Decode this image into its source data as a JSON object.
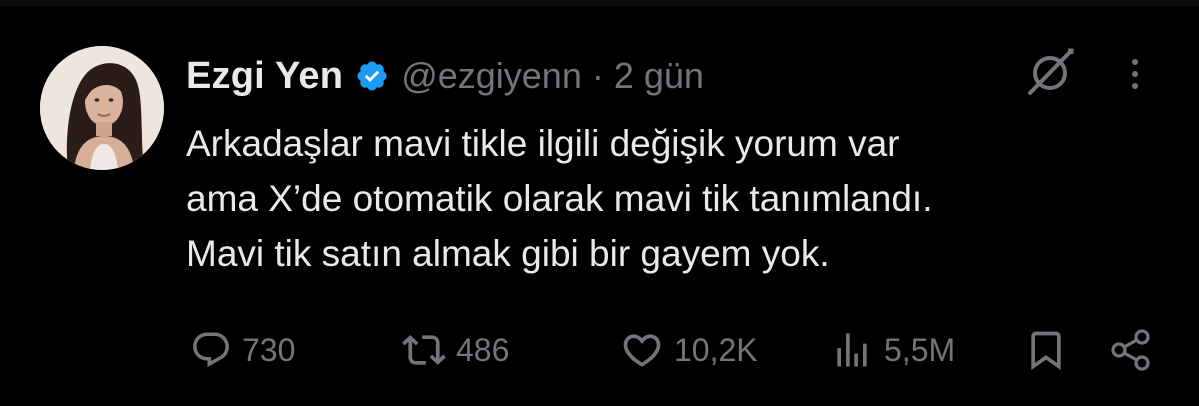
{
  "user": {
    "name": "Ezgi Yen",
    "handle": "@ezgiyenn",
    "separator": "·",
    "time": "2 gün",
    "verified_color": "#1d9bf0"
  },
  "tweet": {
    "lines": [
      "Arkadaşlar mavi tikle ilgili değişik yorum var",
      "ama X’de otomatik olarak mavi tik tanımlandı.",
      "Mavi tik satın almak gibi bir gayem yok."
    ]
  },
  "actions": {
    "replies": "730",
    "reposts": "486",
    "likes": "10,2K",
    "views": "5,5M"
  },
  "icons": {
    "reply": "speech-bubble-icon",
    "repost": "repost-icon",
    "like": "heart-icon",
    "views": "bar-chart-icon",
    "bookmark": "bookmark-icon",
    "share": "share-icon",
    "grok": "grok-icon",
    "more": "more-vertical-icon"
  },
  "colors": {
    "background": "#000000",
    "text": "#e7e9ea",
    "muted": "#71767b"
  }
}
